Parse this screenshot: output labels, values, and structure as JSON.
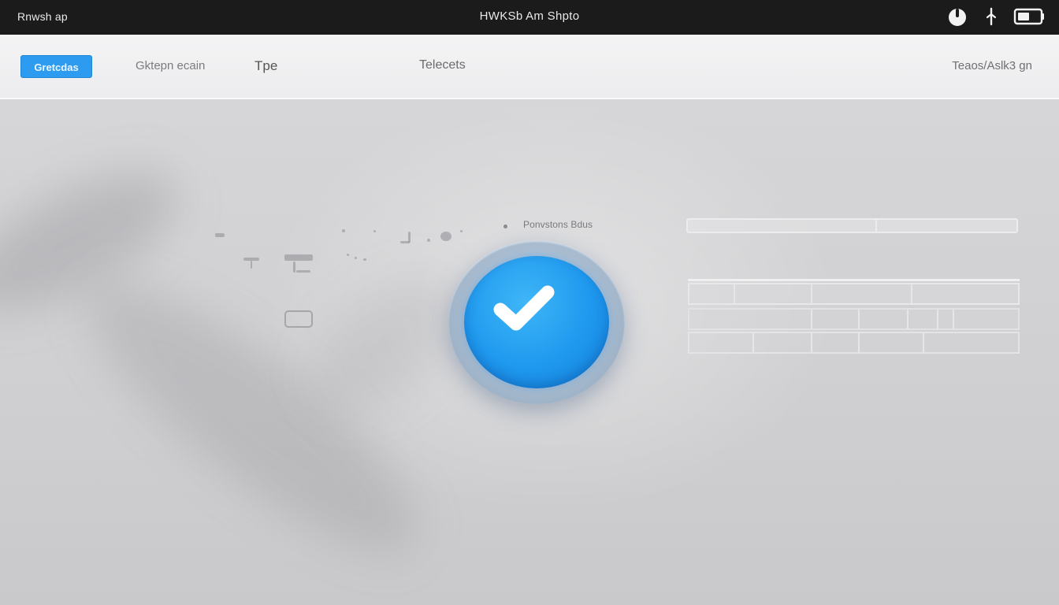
{
  "system_bar": {
    "app_name": "Rnwsh ap",
    "window_title": "HWKSb  Am Shpto",
    "icons": [
      "power-icon",
      "microphone-icon",
      "battery-icon"
    ]
  },
  "toolbar": {
    "primary_button_label": "Gretcdas",
    "nav_links": [
      "Gktepn ecain",
      "Tpe",
      "Telecets"
    ],
    "right_link": "Teaos/Aslk3 gn"
  },
  "canvas": {
    "status_label": "Ponvstons Bdus",
    "success_icon": "checkmark-icon"
  },
  "colors": {
    "accent": "#2d9cf0",
    "badge_blue": "#1e98ee",
    "topbar_bg": "#1b1b1b"
  }
}
